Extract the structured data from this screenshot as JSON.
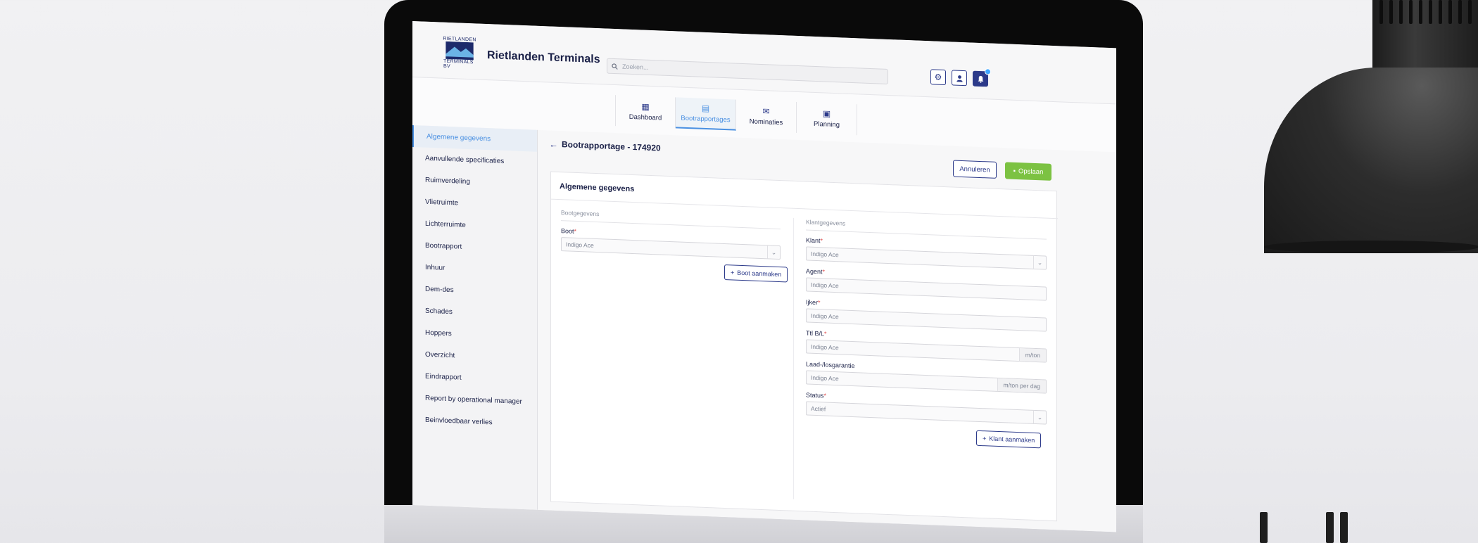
{
  "app": {
    "logo_text_top": "RIETLANDEN",
    "logo_text_bottom": "TERMINALS BV",
    "title": "Rietlanden Terminals",
    "search_placeholder": "Zoeken..."
  },
  "header_icons": [
    "gear-icon",
    "user-icon",
    "bell-icon"
  ],
  "tabs": [
    {
      "label": "Dashboard",
      "icon": "grid-icon",
      "active": false
    },
    {
      "label": "Bootrapportages",
      "icon": "document-icon",
      "active": true
    },
    {
      "label": "Nominaties",
      "icon": "envelope-icon",
      "active": false
    },
    {
      "label": "Planning",
      "icon": "calendar-icon",
      "active": false
    }
  ],
  "sidebar": {
    "items": [
      {
        "label": "Algemene gegevens",
        "active": true
      },
      {
        "label": "Aanvullende specificaties"
      },
      {
        "label": "Ruimverdeling"
      },
      {
        "label": "Vlietruimte"
      },
      {
        "label": "Lichterruimte"
      },
      {
        "label": "Bootrapport"
      },
      {
        "label": "Inhuur"
      },
      {
        "label": "Dem-des"
      },
      {
        "label": "Schades"
      },
      {
        "label": "Hoppers"
      },
      {
        "label": "Overzicht"
      },
      {
        "label": "Eindrapport"
      },
      {
        "label": "Report by operational manager"
      },
      {
        "label": "Beinvloedbaar verlies"
      }
    ]
  },
  "page": {
    "title": "Bootrapportage - 174920",
    "cancel_label": "Annuleren",
    "save_label": "Opslaan"
  },
  "card": {
    "title": "Algemene gegevens",
    "left": {
      "section": "Bootgegevens",
      "boot_label": "Boot",
      "boot_value": "Indigo Ace",
      "add_button": "Boot aanmaken"
    },
    "right": {
      "section": "Klantgegevens",
      "klant_label": "Klant",
      "klant_value": "Indigo Ace",
      "agent_label": "Agent",
      "agent_value": "Indigo Ace",
      "ijker_label": "Ijker",
      "ijker_value": "Indigo Ace",
      "ttl_label": "Ttl B/L",
      "ttl_value": "Indigo Ace",
      "ttl_suffix": "m/ton",
      "laad_label": "Laad-/losgarantie",
      "laad_value": "Indigo Ace",
      "laad_suffix": "m/ton per dag",
      "status_label": "Status",
      "status_value": "Actief",
      "add_button": "Klant aanmaken"
    }
  },
  "colors": {
    "primary": "#2c3a8a",
    "accent": "#4a90e2",
    "save": "#7cc242"
  }
}
